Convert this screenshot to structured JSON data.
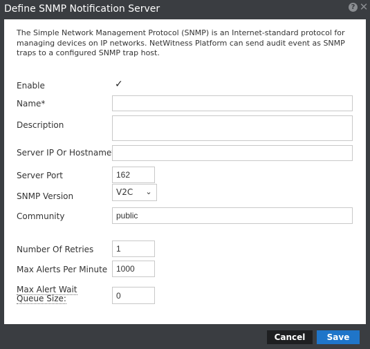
{
  "dialog": {
    "title": "Define SNMP Notification Server",
    "help_icon_glyph": "?",
    "close_icon_glyph": "✕",
    "description": "The Simple Network Management Protocol (SNMP) is an Internet-standard protocol for managing devices on IP networks. NetWitness Platform can send audit event as SNMP traps to a configured SNMP trap host."
  },
  "form": {
    "enable": {
      "label": "Enable",
      "checked": true,
      "glyph": "✓"
    },
    "name": {
      "label": "Name*",
      "value": ""
    },
    "description": {
      "label": "Description",
      "value": ""
    },
    "server_host": {
      "label": "Server IP Or Hostname*",
      "value": ""
    },
    "server_port": {
      "label": "Server Port",
      "value": "162"
    },
    "snmp_version": {
      "label": "SNMP Version",
      "value": "V2C",
      "chevron": "⌄"
    },
    "community": {
      "label": "Community",
      "value": "public"
    },
    "retries": {
      "label": "Number Of Retries",
      "value": "1"
    },
    "max_alerts": {
      "label": "Max Alerts Per Minute",
      "value": "1000"
    },
    "queue_size": {
      "label": "Max Alert Wait Queue Size:",
      "value": "0"
    }
  },
  "footer": {
    "cancel_label": "Cancel",
    "save_label": "Save"
  },
  "colors": {
    "chrome": "#3a3d41",
    "primary_button": "#1f75c9",
    "secondary_button": "#1e1f21"
  }
}
